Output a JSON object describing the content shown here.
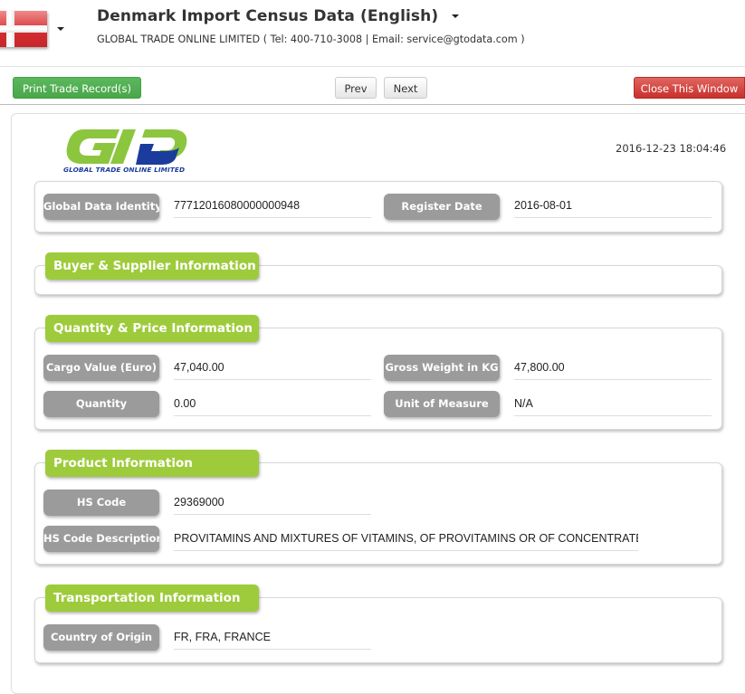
{
  "header": {
    "flag_icon": "denmark-flag-icon",
    "title": "Denmark Import Census Data (English)",
    "subtitle": "GLOBAL TRADE ONLINE LIMITED ( Tel: 400-710-3008 | Email: service@gtodata.com )"
  },
  "toolbar": {
    "print_label": "Print Trade Record(s)",
    "prev_label": "Prev",
    "next_label": "Next",
    "close_label": "Close This Window"
  },
  "record": {
    "logo_text": "GLOBAL TRADE  ONLINE LIMITED",
    "timestamp": "2016-12-23 18:04:46",
    "identity": {
      "global_data_identity_label": "Global Data Identity",
      "global_data_identity_value": "77712016080000000948",
      "register_date_label": "Register Date",
      "register_date_value": "2016-08-01"
    },
    "buyer_supplier": {
      "title": "Buyer & Supplier Information"
    },
    "quantity_price": {
      "title": "Quantity & Price Information",
      "cargo_value_label": "Cargo Value (Euro)",
      "cargo_value": "47,040.00",
      "gross_weight_label": "Gross Weight in KG",
      "gross_weight": "47,800.00",
      "quantity_label": "Quantity",
      "quantity": "0.00",
      "unit_label": "Unit of Measure",
      "unit": "N/A"
    },
    "product": {
      "title": "Product Information",
      "hs_code_label": "HS Code",
      "hs_code": "29369000",
      "hs_desc_label": "HS Code Description",
      "hs_desc": "PROVITAMINS AND MIXTURES OF VITAMINS, OF PROVITAMINS OR OF CONCENTRATES, WH"
    },
    "transportation": {
      "title": "Transportation Information",
      "origin_label": "Country of Origin",
      "origin": "FR, FRA, FRANCE"
    }
  }
}
